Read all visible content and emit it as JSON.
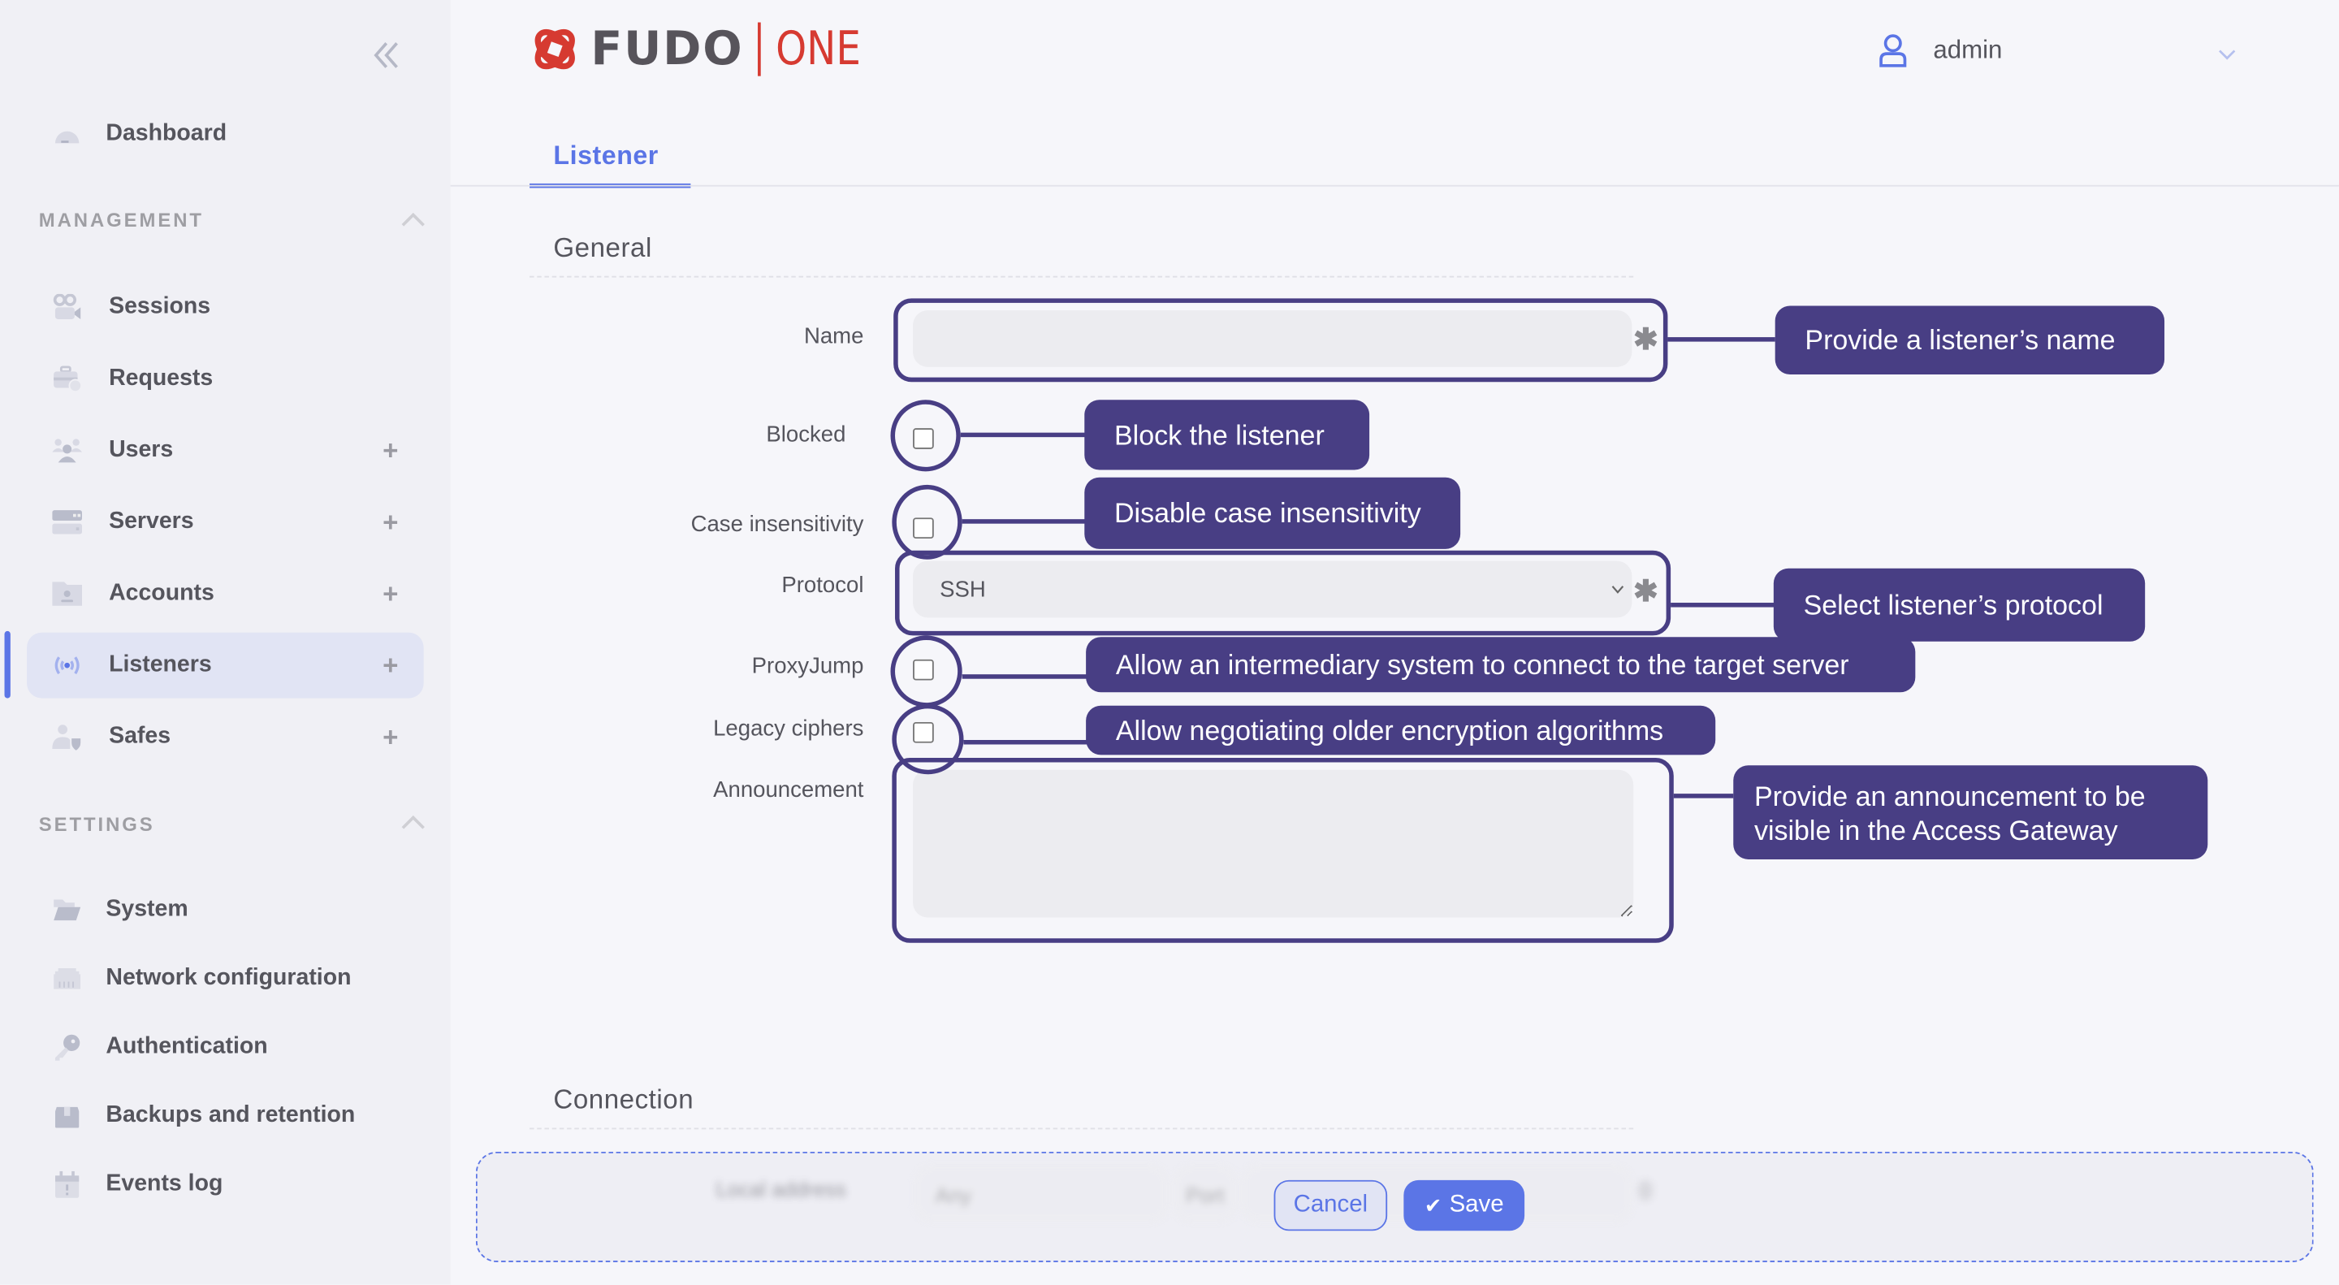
{
  "header": {
    "logo_brand": "FUDO",
    "logo_product": "ONE",
    "user_name": "admin"
  },
  "sidebar": {
    "top_item": {
      "label": "Dashboard",
      "icon": "dashboard-gauge-icon"
    },
    "management": {
      "title": "MANAGEMENT",
      "items": [
        {
          "label": "Sessions",
          "icon": "video-camera-icon",
          "has_add": false
        },
        {
          "label": "Requests",
          "icon": "briefcase-clock-icon",
          "has_add": false
        },
        {
          "label": "Users",
          "icon": "users-icon",
          "has_add": true
        },
        {
          "label": "Servers",
          "icon": "server-icon",
          "has_add": true
        },
        {
          "label": "Accounts",
          "icon": "account-folder-icon",
          "has_add": true
        },
        {
          "label": "Listeners",
          "icon": "broadcast-icon",
          "has_add": true,
          "active": true
        },
        {
          "label": "Safes",
          "icon": "user-shield-icon",
          "has_add": true
        }
      ]
    },
    "settings": {
      "title": "SETTINGS",
      "items": [
        {
          "label": "System",
          "icon": "folder-open-icon"
        },
        {
          "label": "Network configuration",
          "icon": "ethernet-icon"
        },
        {
          "label": "Authentication",
          "icon": "key-icon"
        },
        {
          "label": "Backups and retention",
          "icon": "box-icon"
        },
        {
          "label": "Events log",
          "icon": "calendar-alert-icon"
        }
      ]
    },
    "add_symbol": "+"
  },
  "tabs": [
    {
      "label": "Listener",
      "active": true
    }
  ],
  "form": {
    "general_title": "General",
    "connection_title": "Connection",
    "required_mark": "✱",
    "fields": {
      "name": {
        "label": "Name",
        "value": "",
        "required": true
      },
      "blocked": {
        "label": "Blocked",
        "checked": false
      },
      "case_insensitivity": {
        "label": "Case insensitivity",
        "checked": false
      },
      "protocol": {
        "label": "Protocol",
        "value": "SSH",
        "required": true
      },
      "proxyjump": {
        "label": "ProxyJump",
        "checked": false
      },
      "legacy_ciphers": {
        "label": "Legacy ciphers",
        "checked": false
      },
      "announcement": {
        "label": "Announcement",
        "value": ""
      }
    },
    "connection_preview": {
      "local_address_label": "Local address",
      "local_address_value": "Any",
      "port_label": "Port"
    }
  },
  "annotations": {
    "name": "Provide a listener’s name",
    "blocked": "Block the listener",
    "case_insensitivity": "Disable case insensitivity",
    "protocol": "Select listener’s protocol",
    "proxyjump": "Allow an intermediary system to connect to the target server",
    "legacy_ciphers": "Allow negotiating older encryption algorithms",
    "announcement_line1": "Provide an announcement to be",
    "announcement_line2": "visible in the Access Gateway"
  },
  "actions": {
    "cancel_label": "Cancel",
    "save_label": "Save",
    "save_icon": "✔"
  },
  "colors": {
    "accent": "#5b75e6",
    "annotation": "#483e84",
    "brand_red": "#d63a31"
  }
}
